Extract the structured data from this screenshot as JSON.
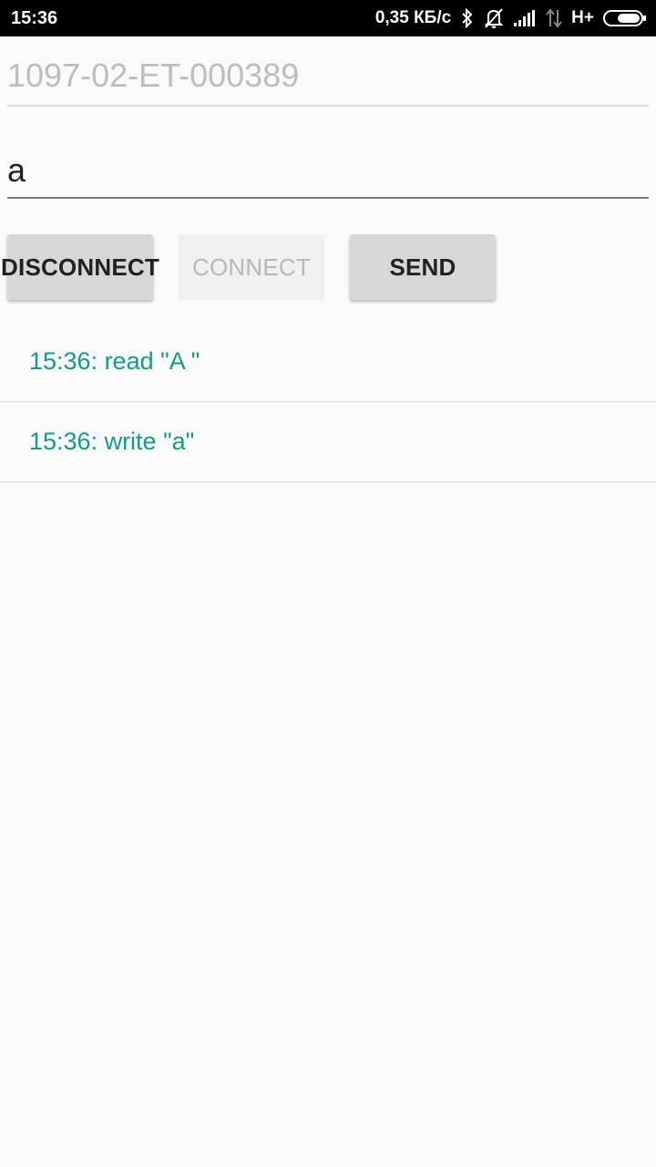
{
  "status_bar": {
    "time": "15:36",
    "net_speed": "0,35 КБ/с",
    "network_type": "H+",
    "icons": [
      "bluetooth-icon",
      "bell-off-icon",
      "signal-icon",
      "data-arrows-icon",
      "battery-icon"
    ]
  },
  "device_field": {
    "placeholder": "1097-02-ET-000389",
    "value": ""
  },
  "message_field": {
    "value": "a"
  },
  "buttons": {
    "disconnect": "DISCONNECT",
    "connect": "CONNECT",
    "send": "SEND"
  },
  "log": [
    "15:36: read \"A \"",
    "15:36: write \"a\""
  ],
  "colors": {
    "log_text": "#139b8c",
    "background": "#fafafa"
  }
}
